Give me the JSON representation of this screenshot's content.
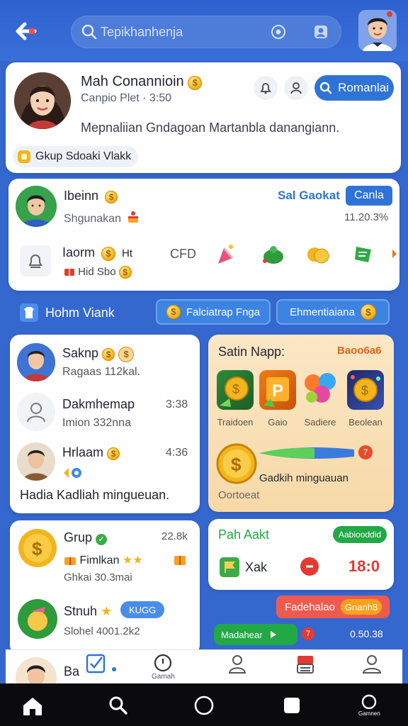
{
  "search": {
    "placeholder": "Tepikhanhenja"
  },
  "profile": {
    "name": "Mah Conannioin",
    "subtitle": "Canpio Plet · 3:50",
    "action_label": "Romanlai",
    "bio": "Mepnaliian Gndagoan Martanbla danangiann.",
    "tag": "Gkup Sdoaki Vlakk"
  },
  "feed": {
    "user_name": "Ibeinn",
    "user_sub": "Shgunakan",
    "link_text": "Sal Gaokat",
    "button_label": "Canla",
    "stat": "11.20.3%",
    "row2_title": "Iaorm",
    "row2_extra": "Ht",
    "row2_code": "CFD",
    "row2_sub": "Hid Sbo"
  },
  "section": {
    "title": "Hohm Viank",
    "btn1": "Falciatrap Fnga",
    "btn2": "Ehmentiaiana"
  },
  "chat": {
    "items": [
      {
        "name": "Saknp",
        "sub": "Ragaas 112kal.",
        "time": ""
      },
      {
        "name": "Dakmhemap",
        "sub": "Imion 332nna",
        "time": "3:38"
      },
      {
        "name": "Hrlaam",
        "sub": "",
        "time": "4:36"
      }
    ],
    "footer_text": "Hadia Kadliah mingueuan."
  },
  "games": {
    "title": "Satin Napp:",
    "badge": "Baoo6a6",
    "tiles": [
      {
        "label": "Traidoen"
      },
      {
        "label": "Gaio"
      },
      {
        "label": "Sadiere"
      },
      {
        "label": "Beolean"
      }
    ],
    "slider_text": "Gadkih minguauan",
    "slider_badge": "7",
    "footer": "Oortoeat"
  },
  "list": {
    "items": [
      {
        "name": "Grup",
        "stat": "22.8k",
        "sub1": "Fimlkan",
        "sub2": "Ghkai 30.3mai"
      },
      {
        "name": "Stnuh",
        "tag": "KUGG",
        "sub": "Slohel 4001.2k2"
      },
      {
        "name": "Ba"
      }
    ]
  },
  "score": {
    "title": "Pah Aakt",
    "badge": "Aabiooddid",
    "item": "Xak",
    "value": "18:0"
  },
  "promo": {
    "label": "Fadehalao",
    "tag": "Gnanh8",
    "progress_label": "Madahear",
    "progress_badge": "7",
    "value": "0.50.38"
  },
  "nav": {
    "items": [
      {
        "label": ""
      },
      {
        "label": "Gamah"
      },
      {
        "label": ""
      },
      {
        "label": ""
      },
      {
        "label": ""
      }
    ],
    "sys_label": "Gamnen"
  },
  "colors": {
    "primary": "#2f73d6",
    "accent": "#f3b51e",
    "green": "#22a845",
    "red": "#e23b33"
  }
}
